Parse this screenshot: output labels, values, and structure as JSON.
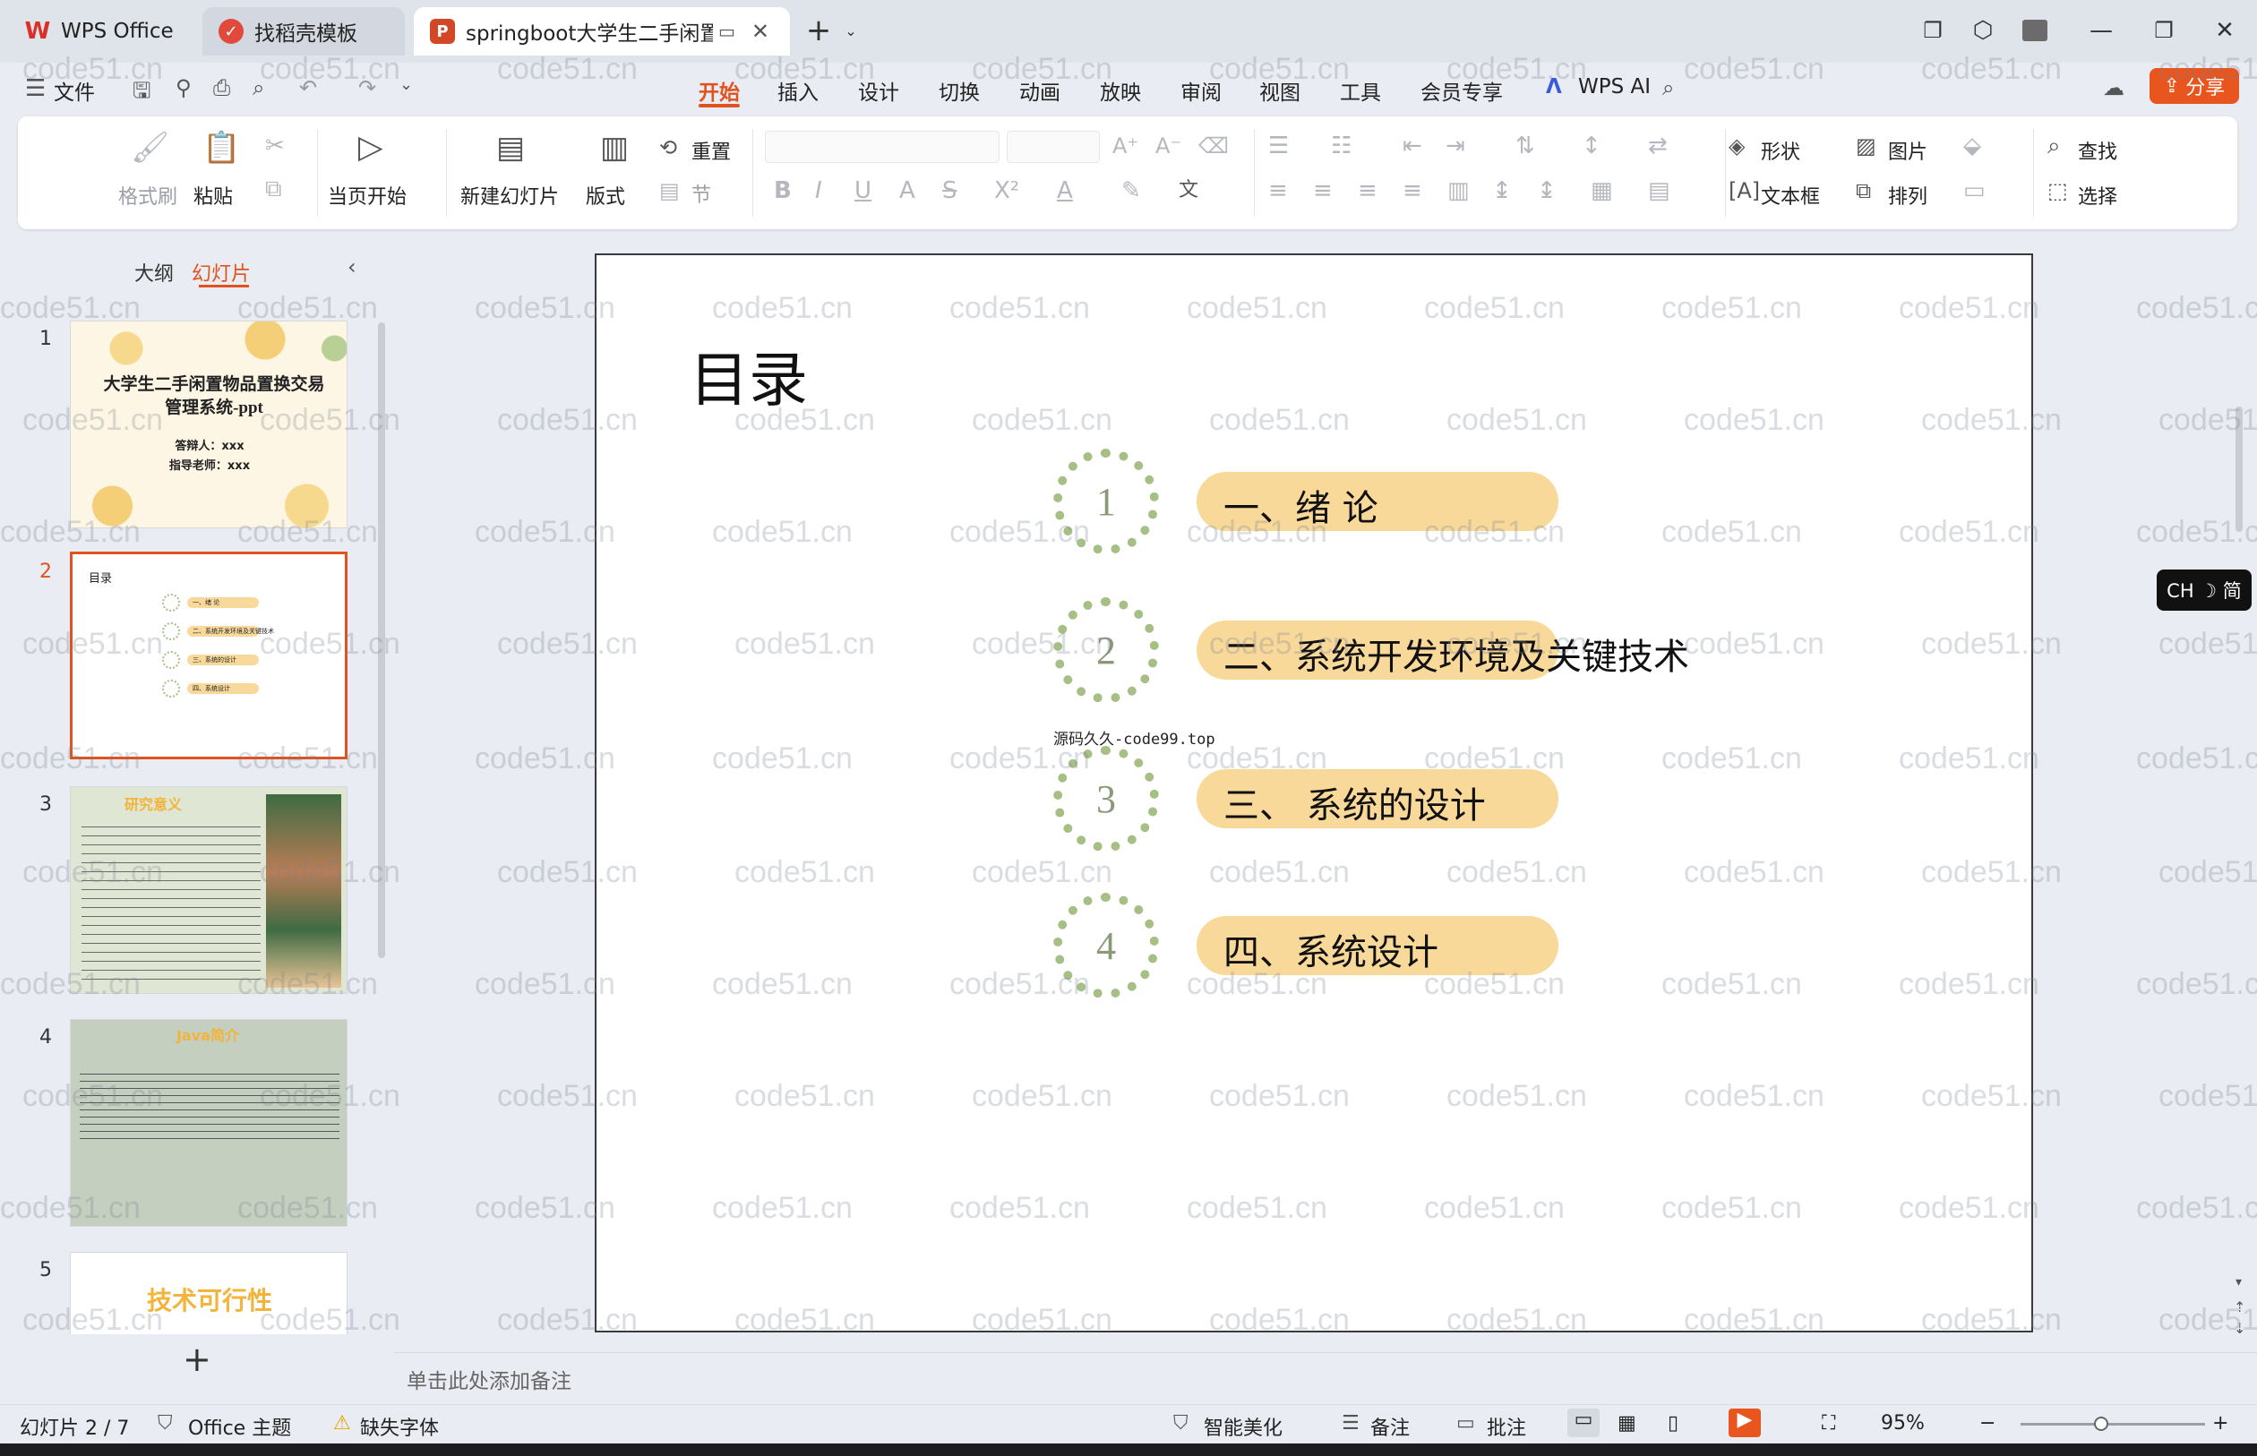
{
  "tabs": [
    {
      "label": "WPS Office",
      "icon": "wps-logo-icon"
    },
    {
      "label": "找稻壳模板",
      "icon": "docer-icon"
    },
    {
      "label": "springboot大学生二手闲置物",
      "icon": "presentation-icon"
    }
  ],
  "menu": {
    "file": "文件",
    "items": [
      "开始",
      "插入",
      "设计",
      "切换",
      "动画",
      "放映",
      "审阅",
      "视图",
      "工具",
      "会员专享"
    ],
    "active": "开始",
    "wps_ai": "WPS AI",
    "share": "分享"
  },
  "ribbon": {
    "format_painter": "格式刷",
    "paste": "粘贴",
    "from_current": "当页开始",
    "new_slide": "新建幻灯片",
    "layout": "版式",
    "reset": "重置",
    "section": "节",
    "shape": "形状",
    "picture": "图片",
    "textbox": "文本框",
    "arrange": "排列",
    "find": "查找",
    "select": "选择"
  },
  "left_panel": {
    "tab_outline": "大纲",
    "tab_slides": "幻灯片",
    "slides": [
      {
        "num": "1",
        "title": "大学生二手闲置物品置换交易管理系统-ppt",
        "line1": "答辩人：xxx",
        "line2": "指导老师：xxx"
      },
      {
        "num": "2",
        "title": "目录",
        "items": [
          "一、绪 论",
          "二、系统开发环境及关键技术",
          "三、系统的设计",
          "四、系统设计"
        ]
      },
      {
        "num": "3",
        "title": "研究意义"
      },
      {
        "num": "4",
        "title": "Java简介"
      },
      {
        "num": "5",
        "title": "技术可行性"
      }
    ],
    "add": "+"
  },
  "slide": {
    "title": "目录",
    "items": [
      {
        "num": "1",
        "text": "一、绪  论"
      },
      {
        "num": "2",
        "text": "二、系统开发环境及关键技术"
      },
      {
        "num": "3",
        "text": "三、 系统的设计"
      },
      {
        "num": "4",
        "text": "四、系统设计"
      }
    ],
    "source_label": "源码久久-code99.top"
  },
  "notes_placeholder": "单击此处添加备注",
  "ime": "CH ☽ 简",
  "status": {
    "slide_counter": "幻灯片 2 / 7",
    "theme": "Office 主题",
    "missing_font": "缺失字体",
    "beautify": "智能美化",
    "notes": "备注",
    "comment": "批注",
    "zoom": "95%"
  },
  "watermark": "code51.cn",
  "colors": {
    "accent": "#e0531f",
    "pill": "#f8d99a",
    "wreath": "#a6bf85"
  }
}
